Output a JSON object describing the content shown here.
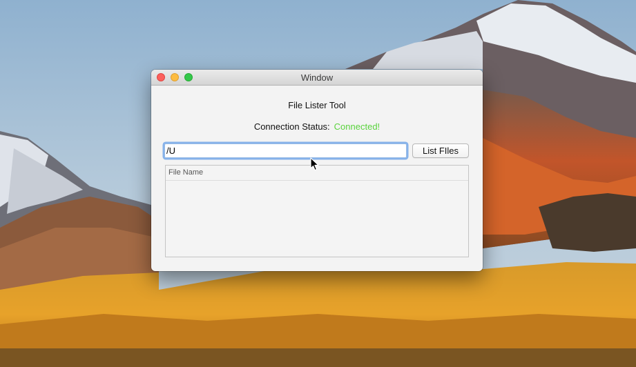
{
  "window": {
    "title": "Window"
  },
  "app": {
    "tool_title": "File Lister Tool",
    "status_label": "Connection Status:",
    "status_value": "Connected!",
    "status_color": "#5ad33d",
    "path_value": "/U",
    "list_button_label": "List FIles",
    "table_header": "File Name",
    "table_rows": []
  },
  "icons": {
    "traffic_lights": [
      "close-icon",
      "minimize-icon",
      "zoom-icon"
    ],
    "pointer": "mouse-pointer-icon"
  }
}
